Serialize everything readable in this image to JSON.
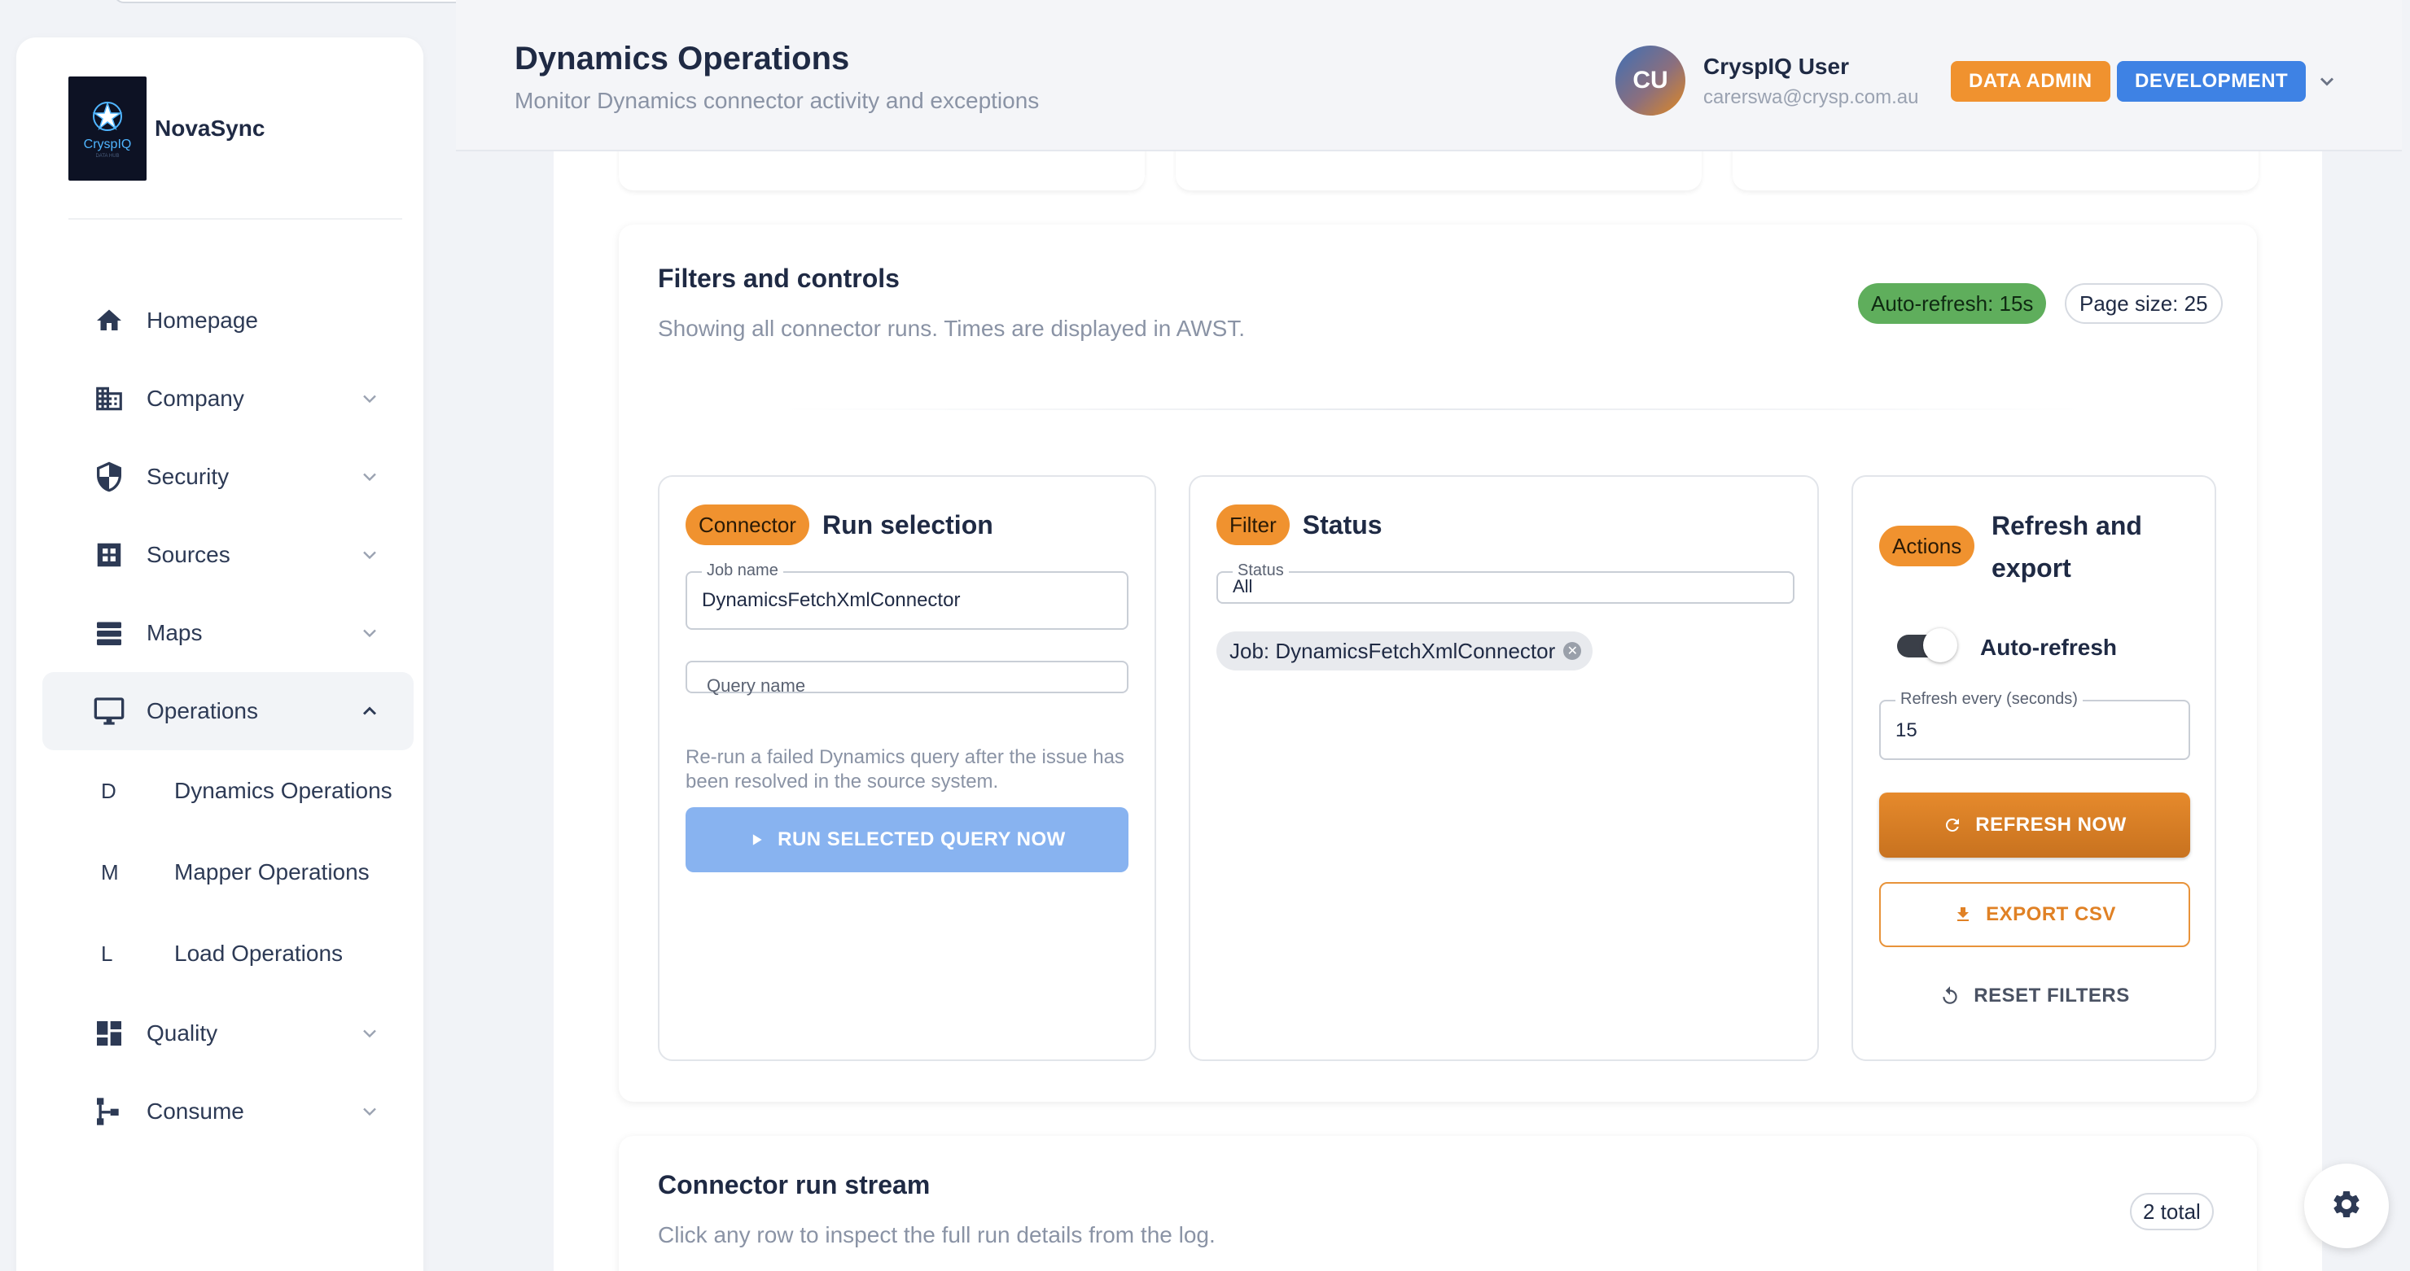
{
  "brand": {
    "name": "NovaSync",
    "logo_text": "CryspIQ",
    "logo_sub": "DATA HUB"
  },
  "sidebar": {
    "items": [
      {
        "label": "Homepage",
        "icon": "home-icon"
      },
      {
        "label": "Company",
        "icon": "building-icon"
      },
      {
        "label": "Security",
        "icon": "shield-icon"
      },
      {
        "label": "Sources",
        "icon": "grid-icon"
      },
      {
        "label": "Maps",
        "icon": "layers-icon"
      },
      {
        "label": "Operations",
        "icon": "monitor-icon"
      },
      {
        "label": "Quality",
        "icon": "dashboard-icon"
      },
      {
        "label": "Consume",
        "icon": "tree-icon"
      }
    ],
    "sub_items": [
      {
        "letter": "D",
        "label": "Dynamics Operations"
      },
      {
        "letter": "M",
        "label": "Mapper Operations"
      },
      {
        "letter": "L",
        "label": "Load Operations"
      }
    ]
  },
  "header": {
    "title": "Dynamics Operations",
    "subtitle": "Monitor Dynamics connector activity and exceptions",
    "avatar_initials": "CU",
    "user_name": "CryspIQ User",
    "user_email": "carerswa@crysp.com.au",
    "badge_role": "DATA ADMIN",
    "badge_env": "DEVELOPMENT"
  },
  "filters": {
    "title": "Filters and controls",
    "subtitle": "Showing all connector runs. Times are displayed in AWST.",
    "auto_refresh_chip": "Auto-refresh: 15s",
    "page_size_chip": "Page size: 25",
    "connector": {
      "chip": "Connector",
      "heading": "Run selection",
      "job_name_label": "Job name",
      "job_name_value": "DynamicsFetchXmlConnector",
      "query_name_label": "Query name",
      "helper": "Re-run a failed Dynamics query after the issue has been resolved in the source system.",
      "run_button": "RUN SELECTED QUERY NOW"
    },
    "status": {
      "chip": "Filter",
      "heading": "Status",
      "status_label": "Status",
      "status_value": "All",
      "job_chip": "Job: DynamicsFetchXmlConnector"
    },
    "actions": {
      "chip": "Actions",
      "heading_line1": "Refresh and",
      "heading_line2": "export",
      "toggle_label": "Auto-refresh",
      "auto_refresh_on": true,
      "interval_label": "Refresh every (seconds)",
      "interval_value": "15",
      "refresh_button": "REFRESH NOW",
      "export_button": "EXPORT CSV",
      "reset_button": "RESET FILTERS"
    }
  },
  "stream": {
    "title": "Connector run stream",
    "subtitle": "Click any row to inspect the full run details from the log.",
    "total_chip": "2 total"
  },
  "colors": {
    "accent_orange": "#f0922f",
    "accent_blue": "#3e82e4",
    "accent_green": "#5fae5c",
    "text_dark": "#1f2a44"
  }
}
